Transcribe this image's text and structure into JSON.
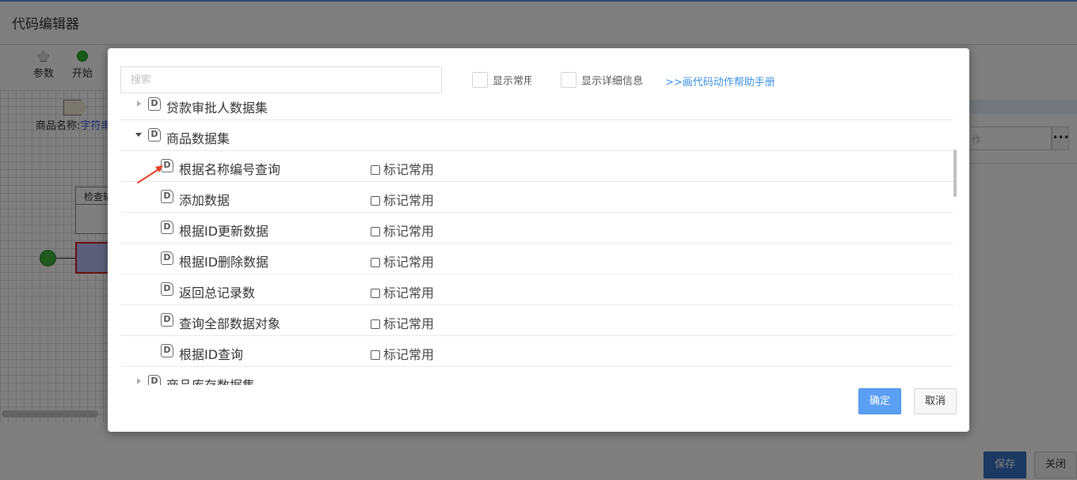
{
  "background": {
    "title": "代码编辑器",
    "toolbar": [
      {
        "label": "参数",
        "icon": "pentagon-icon"
      },
      {
        "label": "开始",
        "icon": "start-circle-icon"
      }
    ],
    "param_node": {
      "name": "商品名称:",
      "type": "字符串"
    },
    "check_node_label": "检查输",
    "right_input_placeholder": "作",
    "right_more": "•••",
    "save_label": "保存",
    "close_label": "关闭"
  },
  "dialog": {
    "search_placeholder": "搜索",
    "show_common_label": "显示常用",
    "show_detail_label": "显示详细信息",
    "help_link": ">>画代码动作帮助手册",
    "confirm_label": "确定",
    "cancel_label": "取消",
    "tree": {
      "group_loan": {
        "label": "贷款审批人数据集",
        "expanded": false
      },
      "group_goods": {
        "label": "商品数据集",
        "expanded": true
      },
      "items": [
        {
          "label": "根据名称编号查询",
          "mark": "标记常用"
        },
        {
          "label": "添加数据",
          "mark": "标记常用"
        },
        {
          "label": "根据ID更新数据",
          "mark": "标记常用"
        },
        {
          "label": "根据ID删除数据",
          "mark": "标记常用"
        },
        {
          "label": "返回总记录数",
          "mark": "标记常用"
        },
        {
          "label": "查询全部数据对象",
          "mark": "标记常用"
        },
        {
          "label": "根据ID查询",
          "mark": "标记常用"
        }
      ],
      "group_stock": {
        "label": "商品库存数据集",
        "expanded": false
      }
    },
    "colors": {
      "accent": "#5b9ff4",
      "link": "#3b8ee6",
      "annotation": "#e8402a"
    }
  }
}
